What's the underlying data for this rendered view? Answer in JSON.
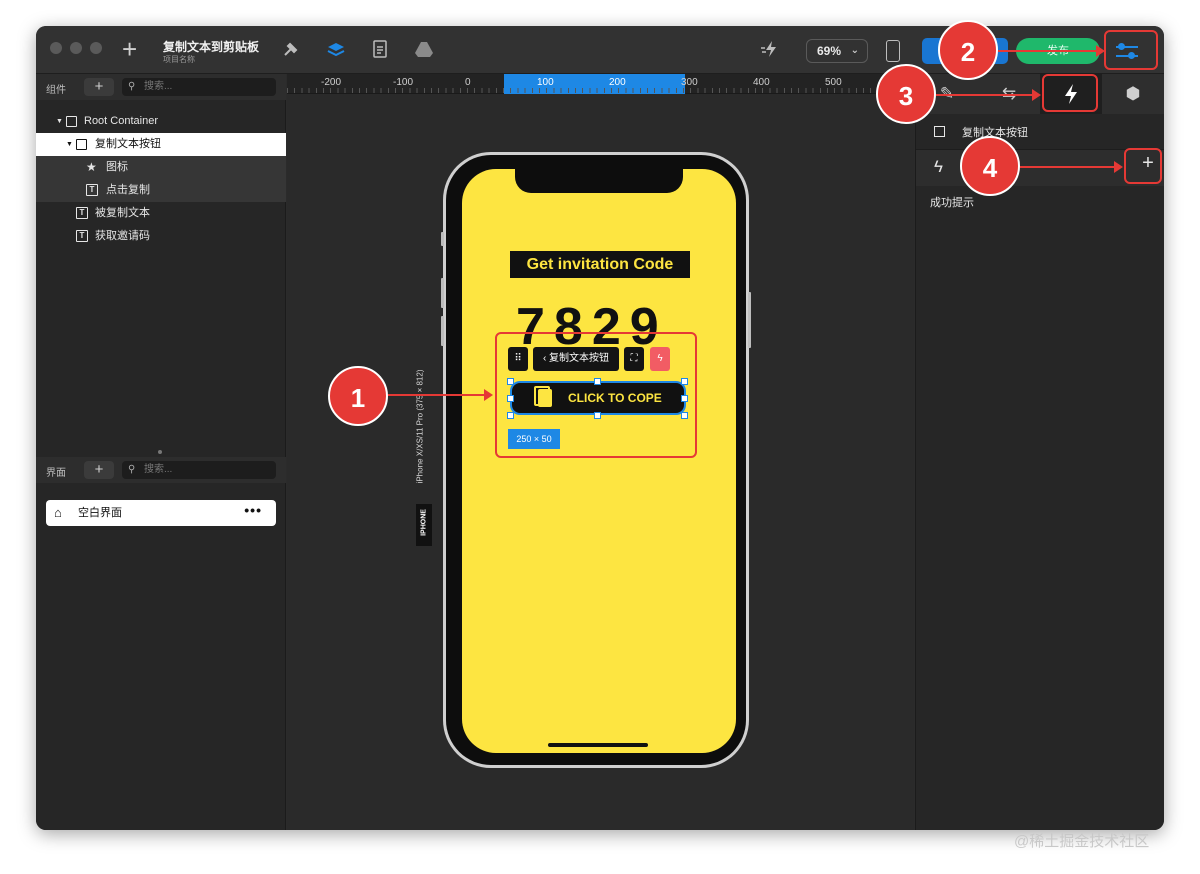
{
  "window": {
    "project_title": "复制文本到剪贴板",
    "project_subtitle": "项目名称",
    "zoom": "69%",
    "publish_label": "发布"
  },
  "components_panel": {
    "label": "组件",
    "search_placeholder": "搜索...",
    "tree": [
      {
        "label": "Root Container"
      },
      {
        "label": "复制文本按钮"
      },
      {
        "label": "图标"
      },
      {
        "label": "点击复制"
      },
      {
        "label": "被复制文本"
      },
      {
        "label": "获取邀请码"
      }
    ]
  },
  "screens_panel": {
    "label": "界面",
    "search_placeholder": "搜索...",
    "items": [
      {
        "label": "空白界面"
      }
    ]
  },
  "ruler": {
    "ticks": [
      "-200",
      "-100",
      "0",
      "100",
      "200",
      "300",
      "400",
      "500"
    ]
  },
  "canvas": {
    "device_caption": "iPhone X/XS/11 Pro (375 × 812)",
    "device_tag": "IPHONE",
    "screen": {
      "title": "Get invitation Code",
      "digits": "7829",
      "component_label": "复制文本按钮",
      "button_label": "CLICK TO COPE",
      "dimension": "250 × 50"
    }
  },
  "right_panel": {
    "element_name": "复制文本按钮",
    "event_name": "成功提示"
  },
  "annotations": [
    "1",
    "2",
    "3",
    "4"
  ],
  "watermark": "@稀土掘金技术社区",
  "colors": {
    "screen_bg": "#fde541",
    "accent_blue": "#1e88e5",
    "publish_green": "#1fb86b",
    "annotation_red": "#e53935"
  },
  "icons": {
    "interaction_tab": "lightning-icon",
    "settings": "sliders-icon",
    "add": "plus-icon"
  }
}
